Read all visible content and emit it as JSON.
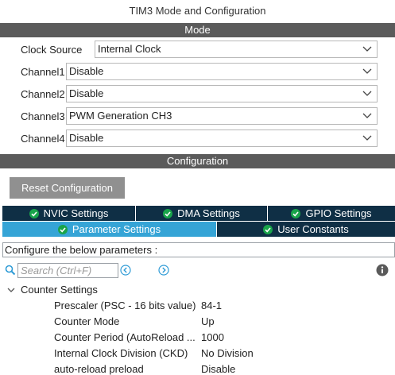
{
  "header": {
    "title": "TIM3 Mode and Configuration"
  },
  "mode": {
    "section_label": "Mode",
    "fields": [
      {
        "label": "Clock Source",
        "value": "Internal Clock"
      },
      {
        "label": "Channel1",
        "value": "Disable"
      },
      {
        "label": "Channel2",
        "value": "Disable"
      },
      {
        "label": "Channel3",
        "value": "PWM Generation CH3"
      },
      {
        "label": "Channel4",
        "value": "Disable"
      }
    ]
  },
  "configuration": {
    "section_label": "Configuration",
    "reset_button": "Reset Configuration",
    "tabs_row1": [
      "NVIC Settings",
      "DMA Settings",
      "GPIO Settings"
    ],
    "tabs_row2": [
      "Parameter Settings",
      "User Constants"
    ],
    "active_tab": "Parameter Settings",
    "instruction": "Configure the below parameters :",
    "search_placeholder": "Search (Ctrl+F)",
    "group_label": "Counter Settings",
    "parameters": [
      {
        "label": "Prescaler (PSC - 16 bits value)",
        "value": "84-1"
      },
      {
        "label": "Counter Mode",
        "value": "Up"
      },
      {
        "label": "Counter Period (AutoReload ...",
        "value": "1000"
      },
      {
        "label": "Internal Clock Division (CKD)",
        "value": "No Division"
      },
      {
        "label": "auto-reload preload",
        "value": "Disable"
      }
    ]
  },
  "colors": {
    "section_bar": "#5b5b5b",
    "tab_dark": "#0f2f45",
    "tab_active": "#35a4d6",
    "check_green": "#19a44a",
    "nav_arrow": "#2e9bd6",
    "reset_button": "#909090"
  },
  "icons": [
    "chevron-down-icon",
    "check-circle-icon",
    "search-icon",
    "arrow-left-circle-icon",
    "arrow-right-circle-icon",
    "info-icon",
    "collapse-chevron-icon"
  ]
}
